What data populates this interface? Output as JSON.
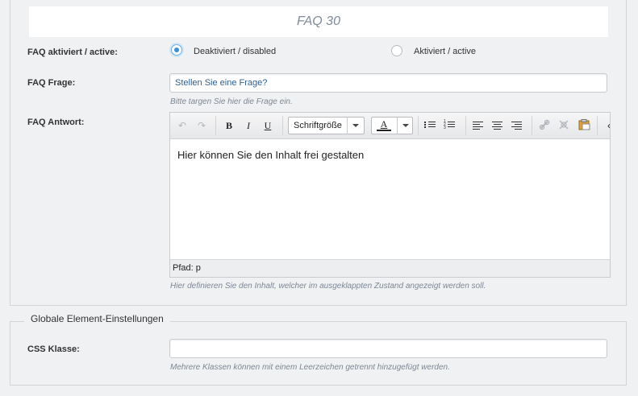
{
  "faq": {
    "title": "FAQ 30",
    "active": {
      "label": "FAQ aktiviert / active:",
      "option_disabled": "Deaktiviert / disabled",
      "option_active": "Aktiviert / active",
      "selected": "disabled"
    },
    "question": {
      "label": "FAQ Frage:",
      "value": "Stellen Sie eine Frage?",
      "hint": "Bitte targen Sie hier die Frage ein."
    },
    "answer": {
      "label": "FAQ Antwort:",
      "content": "Hier können Sie den Inhalt frei gestalten",
      "path": "Pfad: p",
      "hint": "Hier definieren Sie den Inhalt, welcher im ausgeklappten Zustand angezeigt werden soll."
    }
  },
  "toolbar": {
    "fontsize_select": "Schriftgröße",
    "bold": "B",
    "italic": "I",
    "underline": "U",
    "color_letter": "A"
  },
  "global": {
    "legend": "Globale Element-Einstellungen",
    "css_label": "CSS Klasse:",
    "css_value": "",
    "css_hint": "Mehrere Klassen können mit einem Leerzeichen getrennt hinzugefügt werden."
  },
  "colors": {
    "accent": "#3d8fd6",
    "hint_text": "#7d8794",
    "background": "#f0f1f3"
  }
}
